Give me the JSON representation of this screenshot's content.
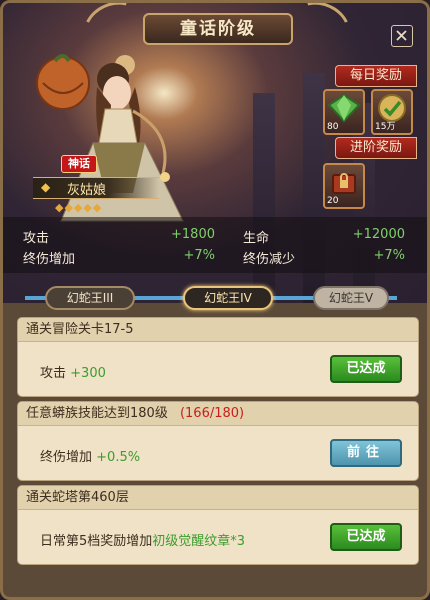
{
  "window": {
    "title": "童话阶级"
  },
  "rewards": {
    "daily_label": "每日奖励",
    "daily_items": [
      {
        "icon": "green-gem-icon",
        "count": "80"
      },
      {
        "icon": "coin-medal-icon",
        "count": "15万"
      }
    ],
    "advance_label": "进阶奖励",
    "advance_items": [
      {
        "icon": "locked-chest-icon",
        "count": "20"
      }
    ]
  },
  "hero": {
    "rarity_badge": "神话",
    "name": "灰姑娘",
    "stars": "◆◆◆◆◆"
  },
  "stats": [
    {
      "label": "攻击",
      "value": "+1800"
    },
    {
      "label": "生命",
      "value": "+12000"
    },
    {
      "label": "终伤增加",
      "value": "+7%"
    },
    {
      "label": "终伤减少",
      "value": "+7%"
    }
  ],
  "tabs": [
    {
      "label": "幻蛇王III",
      "state": "completed"
    },
    {
      "label": "幻蛇王IV",
      "state": "selected"
    },
    {
      "label": "幻蛇王V",
      "state": "locked"
    }
  ],
  "tasks": [
    {
      "title": "通关冒险关卡17-5",
      "progress": "",
      "reward_prefix": "攻击",
      "reward_value": "+300",
      "reward_suffix": "",
      "button": "已达成",
      "status": "done"
    },
    {
      "title": "任意蟒族技能达到180级",
      "progress": "(166/180)",
      "reward_prefix": "终伤增加",
      "reward_value": "+0.5%",
      "reward_suffix": "",
      "button": "前往",
      "status": "go"
    },
    {
      "title": "通关蛇塔第460层",
      "progress": "",
      "reward_prefix": "日常第5档奖励增加",
      "reward_value": "初级觉醒纹章",
      "reward_suffix": "*3",
      "button": "已达成",
      "status": "done"
    }
  ],
  "colors": {
    "accent_green": "#3d9c2e",
    "stat_green": "#7fd06a",
    "progress_red": "#c8201a",
    "tab_track_blue": "#58a6d8"
  }
}
